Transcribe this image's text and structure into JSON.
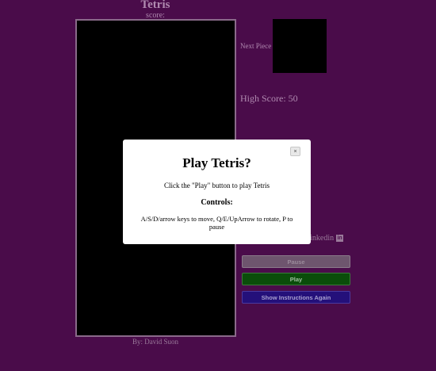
{
  "game": {
    "title": "Tetris",
    "score_label": "score:",
    "next_piece_label": "Next Piece",
    "high_score_label": "High Score: 50",
    "author": "By: David Suon"
  },
  "links": {
    "linkedin_label": "Linkedin",
    "linkedin_icon_letters": "in",
    "linkedin_icon": "linkedin-icon"
  },
  "buttons": {
    "pause": "Pause",
    "play": "Play",
    "show_instructions": "Show Instructions Again"
  },
  "modal": {
    "close": "×",
    "title": "Play Tetris?",
    "text": "Click the \"Play\" button to play Tetris",
    "controls_heading": "Controls:",
    "controls_text": "A/S/D/arrow keys to move, Q/E/UpArrow to rotate, P to pause"
  },
  "colors": {
    "background": "#4a0c4a",
    "board": "#000000",
    "play_button": "#0a4d0a",
    "instructions_button": "#24107a",
    "pause_button": "#6e556e"
  }
}
